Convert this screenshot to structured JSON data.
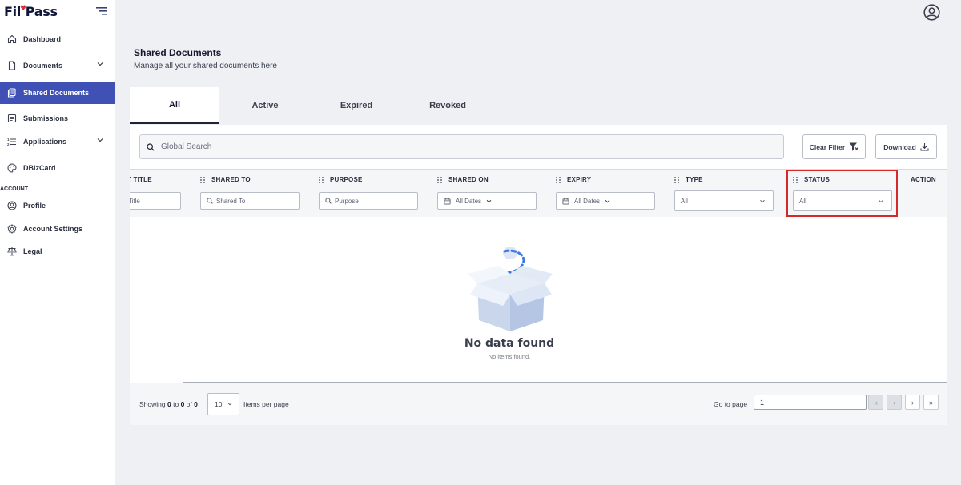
{
  "brand": {
    "name_prefix": "Fil",
    "name_suffix": "ass",
    "heart": "♥"
  },
  "sidebar": {
    "items": [
      {
        "label": "Dashboard",
        "icon": "home-icon"
      },
      {
        "label": "Documents",
        "icon": "document-icon",
        "expandable": true
      },
      {
        "label": "Shared Documents",
        "icon": "shared-documents-icon",
        "active": true
      },
      {
        "label": "Submissions",
        "icon": "submissions-icon"
      },
      {
        "label": "Applications",
        "icon": "applications-icon",
        "expandable": true
      },
      {
        "label": "DBizCard",
        "icon": "palette-icon"
      }
    ],
    "section_label": "ACCOUNT",
    "account_items": [
      {
        "label": "Profile",
        "icon": "profile-icon"
      },
      {
        "label": "Account Settings",
        "icon": "settings-icon"
      },
      {
        "label": "Legal",
        "icon": "scales-icon"
      }
    ]
  },
  "page": {
    "title": "Shared Documents",
    "subtitle": "Manage all your shared documents here"
  },
  "tabs": [
    {
      "label": "All",
      "active": true
    },
    {
      "label": "Active"
    },
    {
      "label": "Expired"
    },
    {
      "label": "Revoked"
    }
  ],
  "toolbar": {
    "search_placeholder": "Global Search",
    "clear_filter_label": "Clear Filter",
    "download_label": "Download"
  },
  "columns": {
    "title": {
      "header": "T TITLE",
      "placeholder": "Title"
    },
    "shared_to": {
      "header": "SHARED TO",
      "placeholder": "Shared To"
    },
    "purpose": {
      "header": "PURPOSE",
      "placeholder": "Purpose"
    },
    "shared_on": {
      "header": "SHARED ON",
      "value": "All Dates"
    },
    "expiry": {
      "header": "EXPIRY",
      "value": "All Dates"
    },
    "type": {
      "header": "TYPE",
      "value": "All"
    },
    "status": {
      "header": "STATUS",
      "value": "All"
    },
    "action": {
      "header": "ACTION"
    }
  },
  "empty_state": {
    "title": "No data found",
    "subtitle": "No items found."
  },
  "pagination": {
    "showing_prefix": "Showing",
    "from": "0",
    "to_label": "to",
    "to": "0",
    "of_label": "of",
    "total": "0",
    "per_page": "10",
    "items_per_page_label": "Items per page",
    "goto_label": "Go to page",
    "goto_value": "1",
    "first": "«",
    "prev": "‹",
    "next": "›",
    "last": "»"
  },
  "colors": {
    "accent": "#3f51b5",
    "highlight": "#d62828",
    "background": "#eef0f4"
  }
}
